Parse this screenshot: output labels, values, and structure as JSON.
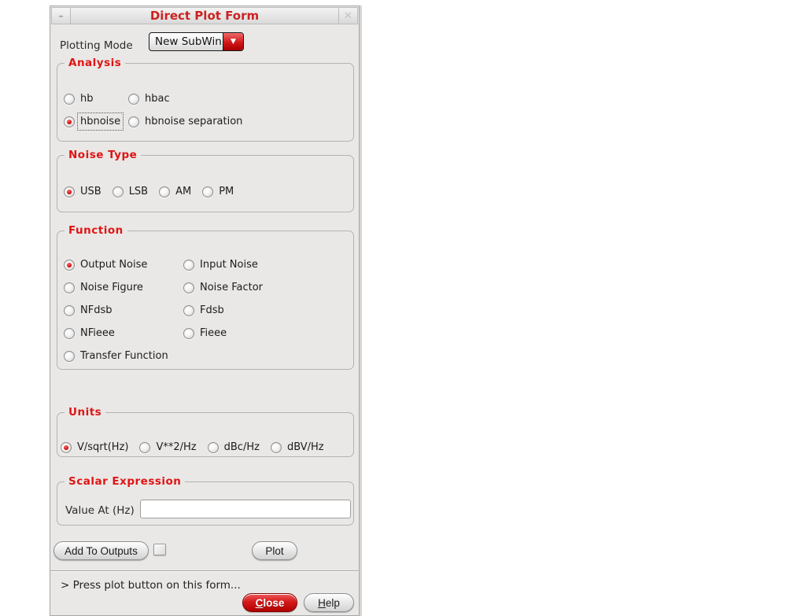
{
  "window": {
    "title": "Direct Plot Form"
  },
  "icons": {
    "minimize": "–",
    "close": "✕",
    "dropdown_arrow": "▼"
  },
  "colors": {
    "accent_red": "#e01414",
    "close_button_red": "#c00000",
    "window_bg": "#e9e8e6"
  },
  "plotting_mode": {
    "label": "Plotting Mode",
    "value": "New SubWin"
  },
  "groups": {
    "analysis": {
      "title": "Analysis",
      "options": [
        {
          "label": "hb",
          "selected": false,
          "focused": false
        },
        {
          "label": "hbac",
          "selected": false,
          "focused": false
        },
        {
          "label": "hbnoise",
          "selected": true,
          "focused": true
        },
        {
          "label": "hbnoise separation",
          "selected": false,
          "focused": false
        }
      ]
    },
    "noise_type": {
      "title": "Noise Type",
      "options": [
        {
          "label": "USB",
          "selected": true,
          "focused": false
        },
        {
          "label": "LSB",
          "selected": false,
          "focused": false
        },
        {
          "label": "AM",
          "selected": false,
          "focused": false
        },
        {
          "label": "PM",
          "selected": false,
          "focused": false
        }
      ]
    },
    "function": {
      "title": "Function",
      "options": [
        {
          "label": "Output Noise",
          "selected": true,
          "focused": false
        },
        {
          "label": "Input Noise",
          "selected": false,
          "focused": false
        },
        {
          "label": "Noise Figure",
          "selected": false,
          "focused": false
        },
        {
          "label": "Noise Factor",
          "selected": false,
          "focused": false
        },
        {
          "label": "NFdsb",
          "selected": false,
          "focused": false
        },
        {
          "label": "Fdsb",
          "selected": false,
          "focused": false
        },
        {
          "label": "NFieee",
          "selected": false,
          "focused": false
        },
        {
          "label": "Fieee",
          "selected": false,
          "focused": false
        },
        {
          "label": "Transfer Function",
          "selected": false,
          "focused": false
        }
      ]
    },
    "units": {
      "title": "Units",
      "options": [
        {
          "label": "V/sqrt(Hz)",
          "selected": true,
          "focused": false
        },
        {
          "label": "V**2/Hz",
          "selected": false,
          "focused": false
        },
        {
          "label": "dBc/Hz",
          "selected": false,
          "focused": false
        },
        {
          "label": "dBV/Hz",
          "selected": false,
          "focused": false
        }
      ]
    },
    "scalar_expression": {
      "title": "Scalar Expression",
      "field_label": "Value At (Hz)",
      "field_value": ""
    }
  },
  "actions": {
    "add_to_outputs": "Add To Outputs",
    "plot": "Plot",
    "close": "Close",
    "help": "Help"
  },
  "status": "> Press plot button on this form..."
}
